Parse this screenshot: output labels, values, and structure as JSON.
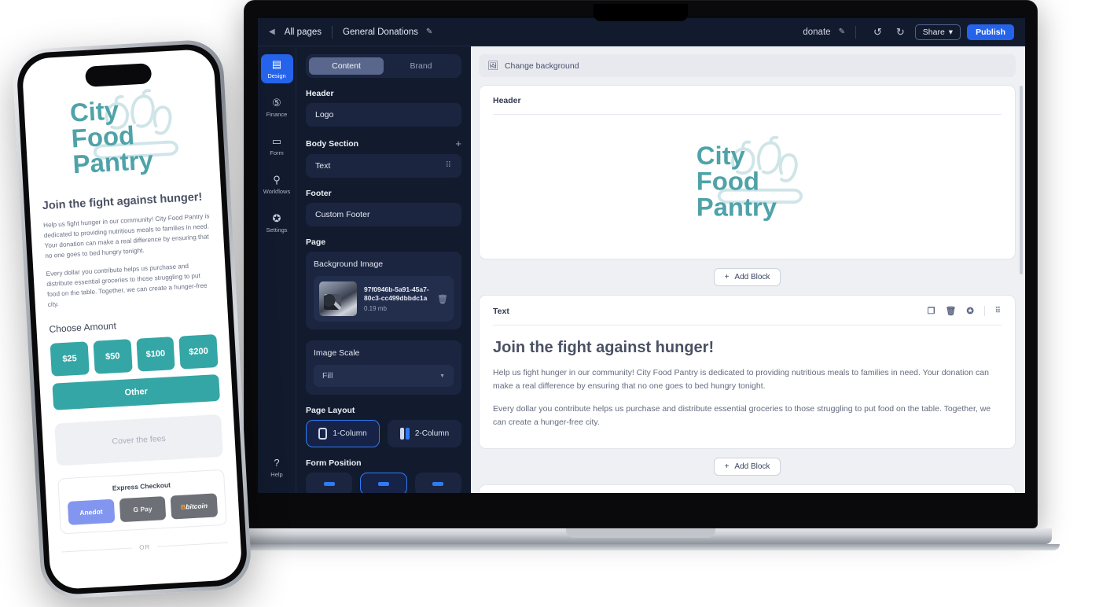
{
  "topbar": {
    "back_icon": "chevron-left-icon",
    "all_pages": "All pages",
    "page_title": "General Donations",
    "edit_icon": "pencil-icon",
    "donate_label": "donate",
    "donate_edit_icon": "pencil-icon",
    "undo_icon": "undo-icon",
    "redo_icon": "redo-icon",
    "share_label": "Share",
    "share_caret": "▾",
    "publish_label": "Publish",
    "publish_color": "#2563eb"
  },
  "rail": {
    "items": [
      {
        "label": "Design",
        "icon": "layout-icon",
        "active": true
      },
      {
        "label": "Finance",
        "icon": "dollar-circle-icon",
        "active": false
      },
      {
        "label": "Form",
        "icon": "form-field-icon",
        "active": false
      },
      {
        "label": "Workflows",
        "icon": "workflow-icon",
        "active": false
      },
      {
        "label": "Settings",
        "icon": "gear-icon",
        "active": false
      }
    ],
    "help": {
      "label": "Help",
      "icon": "question-circle-icon"
    }
  },
  "panel": {
    "tabs": [
      {
        "label": "Content",
        "active": true
      },
      {
        "label": "Brand",
        "active": false
      }
    ],
    "header_label": "Header",
    "header_value": "Logo",
    "body_section_label": "Body Section",
    "body_add_icon": "plus-icon",
    "body_value": "Text",
    "body_drag_icon": "drag-handle-icon",
    "footer_label": "Footer",
    "footer_value": "Custom Footer",
    "page_label": "Page",
    "background_image_label": "Background Image",
    "image_name": "97f0946b-5a91-45a7-80c3-cc499dbbdc1a",
    "image_size": "0.19 mb",
    "image_delete_icon": "trash-icon",
    "image_scale_label": "Image Scale",
    "image_scale_value": "Fill",
    "page_layout_label": "Page Layout",
    "page_layout_options": [
      {
        "label": "1-Column",
        "selected": true
      },
      {
        "label": "2-Column",
        "selected": false
      }
    ],
    "form_position_label": "Form Position",
    "form_position_options": [
      {
        "name": "left",
        "selected": false
      },
      {
        "name": "center",
        "selected": true
      },
      {
        "name": "right",
        "selected": false
      }
    ]
  },
  "canvas": {
    "change_background": "Change background",
    "change_background_icon": "image-icon",
    "header_block": {
      "title": "Header",
      "logo_line1": "City",
      "logo_line2": "Food",
      "logo_line3": "Pantry",
      "logo_color": "#4fa3a8",
      "logo_veg_color": "#cfe5e8"
    },
    "add_block_label": "Add Block",
    "add_block_icon": "plus-icon",
    "text_block": {
      "title": "Text",
      "copy_icon": "duplicate-icon",
      "delete_icon": "trash-icon",
      "settings_icon": "gear-icon",
      "drag_icon": "drag-handle-icon",
      "heading": "Join the fight against hunger!",
      "paragraph1": "Help us fight hunger in our community! City Food Pantry is dedicated to providing nutritious meals to families in need. Your donation can make a real difference by ensuring that no one goes to bed hungry tonight.",
      "paragraph2": "Every dollar you contribute helps us purchase and distribute essential groceries to those struggling to put food on the table. Together, we can create a hunger-free city."
    },
    "add_block_label_2": "Add Block"
  },
  "phone": {
    "logo_line1": "City",
    "logo_line2": "Food",
    "logo_line3": "Pantry",
    "heading": "Join the fight against hunger!",
    "paragraph1": "Help us fight hunger in our community! City Food Pantry is dedicated to providing nutritious meals to families in need. Your donation can make a real difference by ensuring that no one goes to bed hungry tonight.",
    "paragraph2": "Every dollar you contribute helps us purchase and distribute essential groceries to those struggling to put food on the table. Together, we can create a hunger-free city.",
    "choose_amount_label": "Choose Amount",
    "amounts": [
      "$25",
      "$50",
      "$100",
      "$200"
    ],
    "other_label": "Other",
    "cover_fees_label": "Cover the fees",
    "express_checkout_label": "Express Checkout",
    "express_buttons": [
      {
        "label": "Anedot",
        "style": "anedot"
      },
      {
        "label": "Pay",
        "prefix": "G",
        "style": "gpay"
      },
      {
        "label": "bitcoin",
        "prefix": "B",
        "style": "bitcoin"
      }
    ],
    "or_label": "OR",
    "accent_color": "#35a6a6"
  }
}
